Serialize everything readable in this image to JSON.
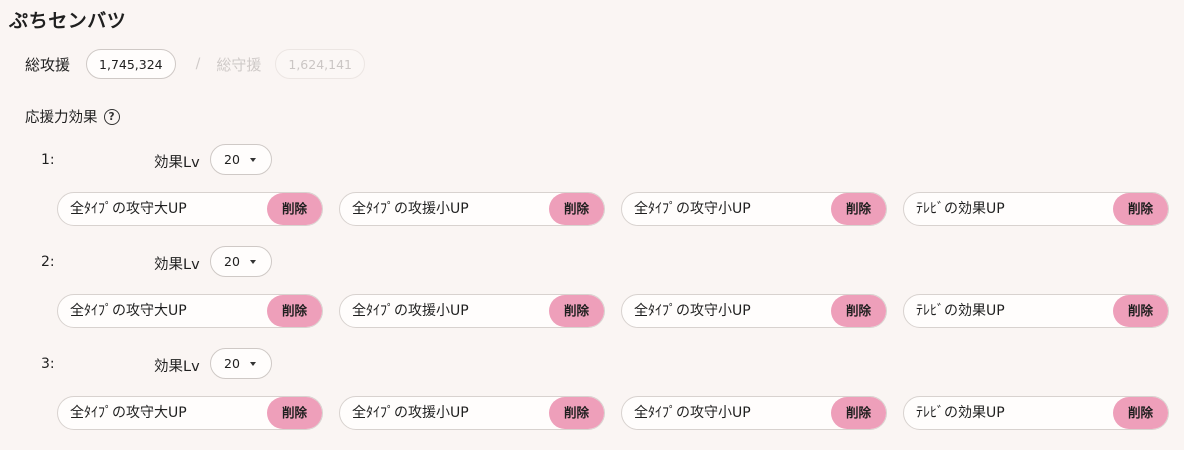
{
  "title": "ぷちセンバツ",
  "totals": {
    "attack_label": "総攻援",
    "attack_value": "1,745,324",
    "separator": "/",
    "defense_label": "総守援",
    "defense_value": "1,624,141"
  },
  "support_effect": {
    "heading": "応援力効果",
    "help_icon": "help-circle-icon",
    "lv_label": "効果Lv",
    "delete_label": "削除",
    "groups": [
      {
        "number": "1:",
        "level": "20",
        "effects": [
          "全ﾀｲﾌﾟの攻守大UP",
          "全ﾀｲﾌﾟの攻援小UP",
          "全ﾀｲﾌﾟの攻守小UP",
          "ﾃﾚﾋﾞの効果UP"
        ]
      },
      {
        "number": "2:",
        "level": "20",
        "effects": [
          "全ﾀｲﾌﾟの攻守大UP",
          "全ﾀｲﾌﾟの攻援小UP",
          "全ﾀｲﾌﾟの攻守小UP",
          "ﾃﾚﾋﾞの効果UP"
        ]
      },
      {
        "number": "3:",
        "level": "20",
        "effects": [
          "全ﾀｲﾌﾟの攻守大UP",
          "全ﾀｲﾌﾟの攻援小UP",
          "全ﾀｲﾌﾟの攻守小UP",
          "ﾃﾚﾋﾞの効果UP"
        ]
      }
    ]
  },
  "colors": {
    "background": "#faf5f3",
    "delete_button": "#ee9fba",
    "border": "#d8d2cf",
    "dim_text": "#cfcac8"
  }
}
